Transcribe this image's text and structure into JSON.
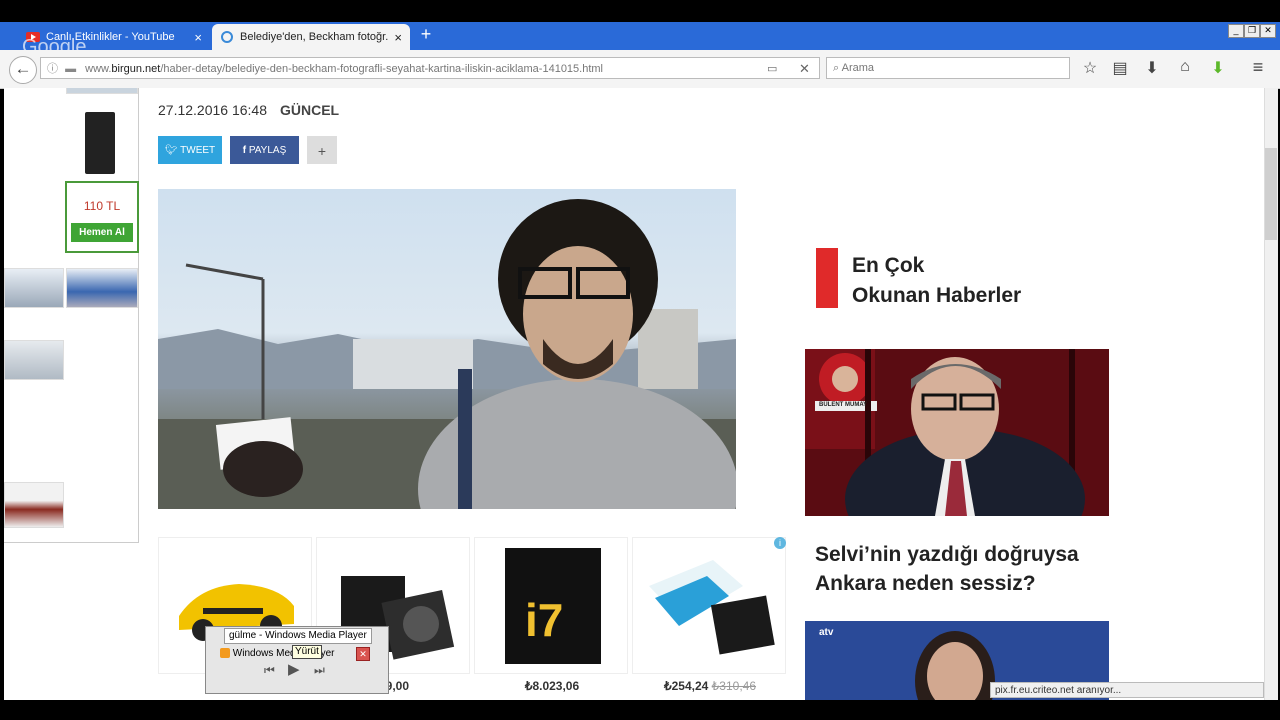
{
  "tabs": [
    {
      "title": "Canlı Etkinlikler - YouTube",
      "close": "×"
    },
    {
      "title": "Belediye'den, Beckham fotoğr...",
      "close": "×"
    }
  ],
  "new_tab": "+",
  "window_controls": [
    "_",
    "❐",
    "✕"
  ],
  "overlay_logo": "Google",
  "url": {
    "prefix": "www.",
    "host": "birgun.net",
    "path": "/haber-detay/belediye-den-beckham-fotografli-seyahat-kartina-iliskin-aciklama-141015.html"
  },
  "search": {
    "placeholder": "Arama"
  },
  "toolbar_icons": [
    "star-icon",
    "reading-list-icon",
    "download-icon",
    "home-icon",
    "addon-icon",
    "menu-icon"
  ],
  "left_ad": {
    "price": "110 TL",
    "buy_label": "Hemen Al"
  },
  "article": {
    "date": "27.12.2016 16:48",
    "category": "GÜNCEL"
  },
  "share": {
    "tweet": "TWEET",
    "facebook": "PAYLAŞ",
    "more": "+"
  },
  "products": [
    {
      "price": "",
      "old_price": ""
    },
    {
      "price": "49,00",
      "old_price": ""
    },
    {
      "price": "₺8.023,06",
      "old_price": ""
    },
    {
      "price": "₺254,24",
      "old_price": "₺310,46"
    }
  ],
  "sidebar": {
    "popular_line1": "En Çok",
    "popular_line2": "Okunan Haberler",
    "news1_title": "Selvi’nin yazdığı doğruysa Ankara neden sessiz?",
    "news1_caption": "BÜLENT MUMAY",
    "news2_tag": "atv"
  },
  "status_text": "pix.fr.eu.criteo.net aranıyor...",
  "wmp": {
    "title": "gülme  - Windows Media Player",
    "label": "Windows Media Player",
    "tooltip": "Yürüt",
    "close": "✕"
  },
  "colors": {
    "tabbar": "#2a6ad8",
    "tweet": "#2fa4de",
    "facebook": "#3b5998",
    "red_accent": "#e02a2a",
    "buy": "#3fa535"
  }
}
